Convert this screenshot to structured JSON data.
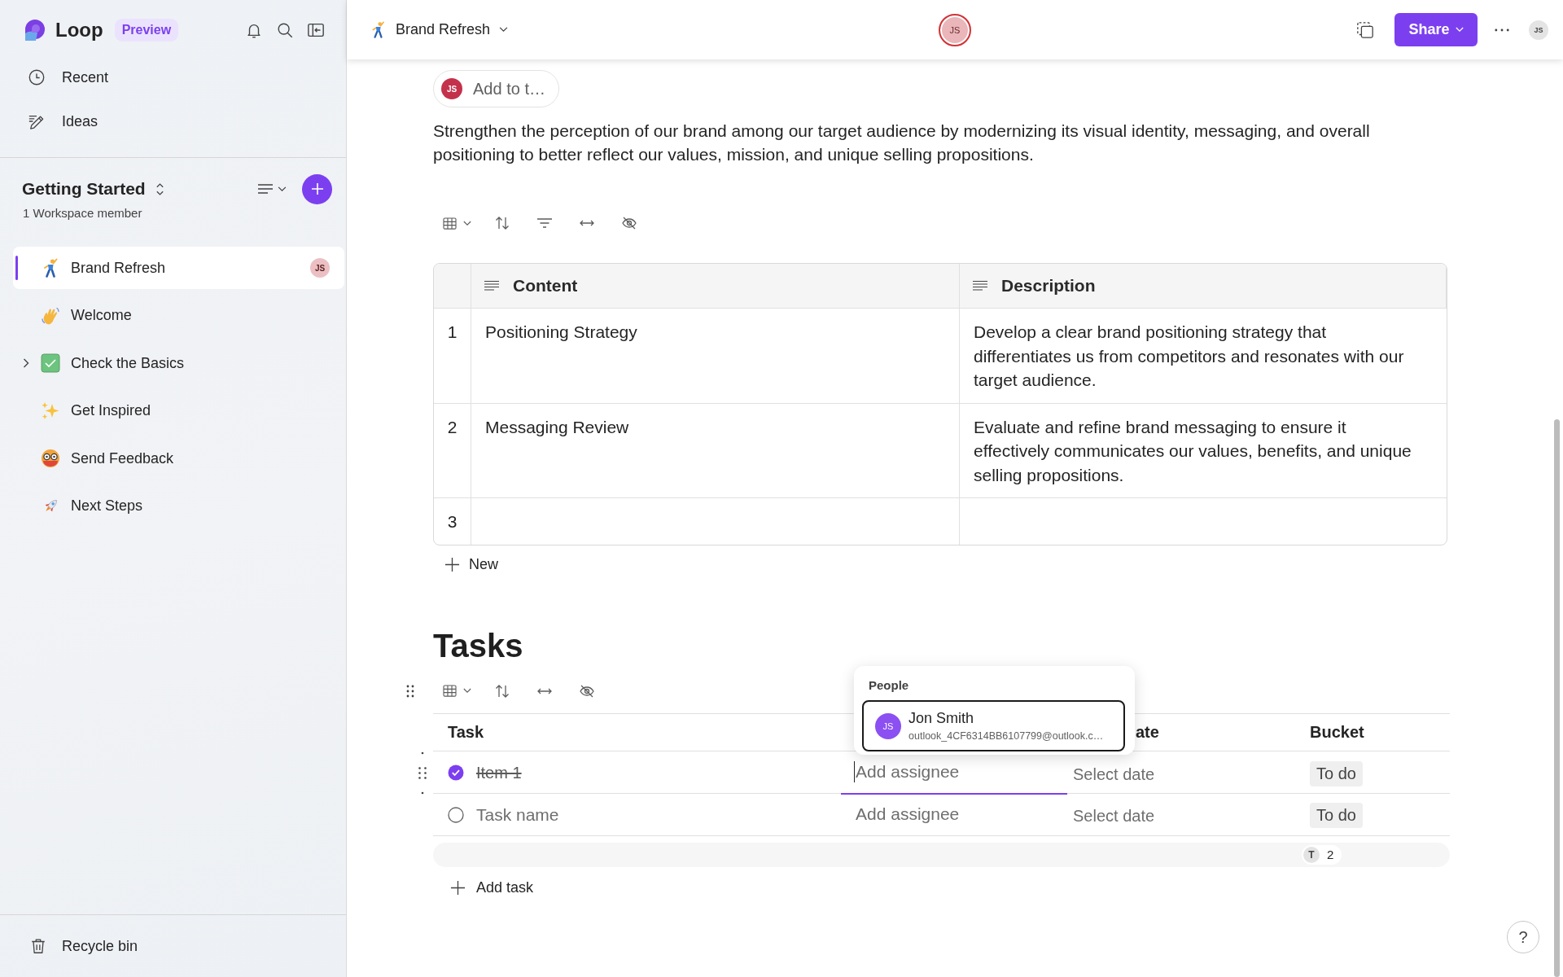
{
  "sidebar": {
    "app_name": "Loop",
    "badge": "Preview",
    "nav": [
      {
        "label": "Recent"
      },
      {
        "label": "Ideas"
      }
    ],
    "workspace": {
      "title": "Getting Started",
      "subtitle": "1 Workspace member"
    },
    "pages": [
      {
        "kind": "page",
        "label": "Brand Refresh",
        "selected": true,
        "avatar": "JS"
      },
      {
        "kind": "page",
        "label": "Welcome",
        "selected": false
      },
      {
        "kind": "group",
        "label": "Check the Basics",
        "selected": false,
        "expanded": false
      },
      {
        "kind": "page",
        "label": "Get Inspired",
        "selected": false
      },
      {
        "kind": "page",
        "label": "Send Feedback",
        "selected": false
      },
      {
        "kind": "page",
        "label": "Next Steps",
        "selected": false
      }
    ],
    "footer": {
      "label": "Recycle bin"
    }
  },
  "topbar": {
    "page_title": "Brand Refresh",
    "presence_avatar": "JS",
    "share_label": "Share",
    "user_avatar": "JS"
  },
  "document": {
    "add_to_chip": {
      "avatar": "JS",
      "label": "Add to t…"
    },
    "description": "Strengthen the perception of our brand among our target audience by modernizing its visual identity, messaging, and overall positioning to better reflect our values, mission, and unique selling propositions.",
    "table": {
      "columns": [
        {
          "label": "Content"
        },
        {
          "label": "Description"
        }
      ],
      "rows": [
        {
          "number": "1",
          "content": "Positioning Strategy",
          "description": "Develop a clear brand positioning strategy that differentiates us from competitors and resonates with our target audience."
        },
        {
          "number": "2",
          "content": "Messaging Review",
          "description": "Evaluate and refine brand messaging to ensure it effectively communicates our values, benefits, and unique selling propositions."
        },
        {
          "number": "3"
        }
      ],
      "new_label": "New"
    }
  },
  "tasks": {
    "heading": "Tasks",
    "columns": [
      {
        "kind": "header",
        "label": "Task"
      },
      {
        "kind": "covered"
      },
      {
        "kind": "partly-covered",
        "label": "ate"
      },
      {
        "kind": "header",
        "label": "Bucket"
      }
    ],
    "rows": [
      {
        "checked": true,
        "active": true,
        "task": {
          "value": "Item 1"
        },
        "assignee": {
          "placeholder": "Add assignee",
          "focused": true
        },
        "due_date": {
          "placeholder": "Select date"
        },
        "bucket": "To do"
      },
      {
        "checked": false,
        "active": false,
        "task": {
          "placeholder": "Task name"
        },
        "assignee": {
          "placeholder": "Add assignee",
          "focused": false
        },
        "due_date": {
          "placeholder": "Select date"
        },
        "bucket": "To do"
      }
    ],
    "summary": {
      "avatar": "T",
      "count": "2"
    },
    "add_label": "Add task"
  },
  "people_popup": {
    "title": "People",
    "options": [
      {
        "avatar": "JS",
        "name": "Jon Smith",
        "email": "outlook_4CF6314BB6107799@outlook.c…",
        "selected": true
      }
    ]
  },
  "help": {
    "label": "?"
  }
}
